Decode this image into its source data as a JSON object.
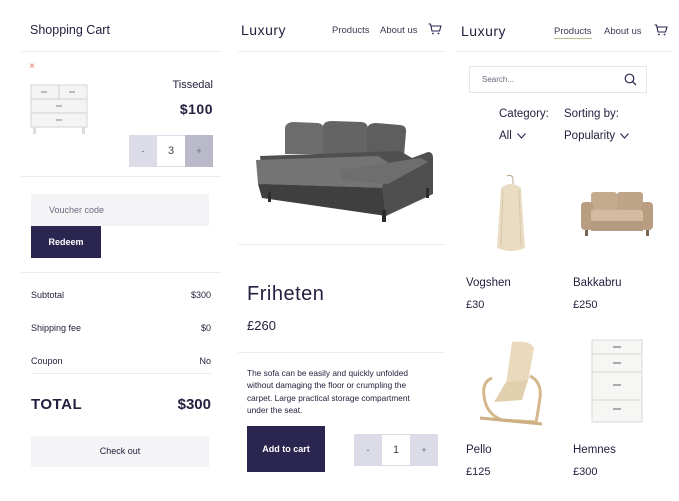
{
  "cart": {
    "title": "Shopping Cart",
    "remove_glyph": "×",
    "item": {
      "name": "Tissedal",
      "price": "$100",
      "qty": "3",
      "minus": "-",
      "plus": "+"
    },
    "voucher_placeholder": "Voucher code",
    "redeem_label": "Redeem",
    "summary": [
      {
        "label": "Subtotal",
        "value": "$300"
      },
      {
        "label": "Shipping fee",
        "value": "$0"
      },
      {
        "label": "Coupon",
        "value": "No"
      }
    ],
    "total_label": "TOTAL",
    "total_value": "$300",
    "checkout_label": "Check out"
  },
  "product": {
    "logo": "Luxury",
    "nav": [
      "Products",
      "About us"
    ],
    "name": "Friheten",
    "price": "£260",
    "description": "The sofa can be easily and quickly unfolded without damaging the floor or crumpling the carpet. Large practical storage compartment under the seat.",
    "add_to_cart": "Add to cart",
    "qty": "1",
    "minus": "-",
    "plus": "+"
  },
  "listing": {
    "logo": "Luxury",
    "nav": [
      "Products",
      "About us"
    ],
    "active_nav": "Products",
    "search_placeholder": "Search...",
    "category_label": "Category:",
    "category_value": "All",
    "sorting_label": "Sorting by:",
    "sorting_value": "Popularity",
    "items": [
      {
        "name": "Vogshen",
        "price": "£30"
      },
      {
        "name": "Bakkabru",
        "price": "£250"
      },
      {
        "name": "Pello",
        "price": "£125"
      },
      {
        "name": "Hemnes",
        "price": "£300"
      }
    ]
  },
  "colors": {
    "primary": "#2a2650",
    "accent": "#b6c08f",
    "remove": "#e26b6b",
    "stepper": "#dcdce8"
  }
}
